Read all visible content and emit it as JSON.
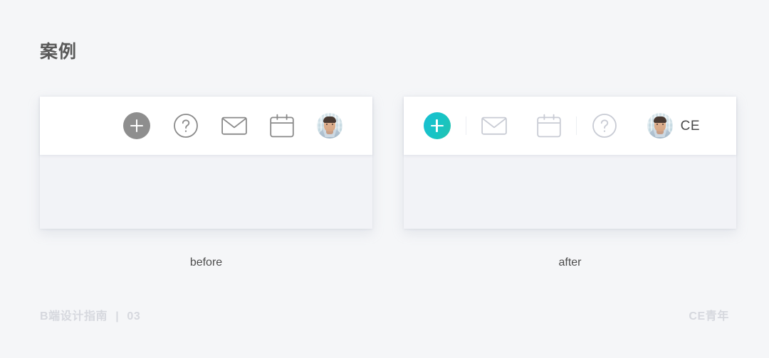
{
  "page": {
    "title": "案例",
    "background_color": "#f5f6f8"
  },
  "colors": {
    "accent_teal": "#17c4c4",
    "before_plus_gray": "#8e8e8e",
    "before_icon_gray": "#8a8a8a",
    "after_icon_gray": "#c8cbd4",
    "card_body": "#f2f3f7",
    "toolbar_white": "#ffffff",
    "title_text": "#595959",
    "footer_text": "#d6d8de"
  },
  "examples": [
    {
      "id": "before",
      "caption": "before",
      "toolbar": {
        "items": [
          {
            "name": "add-button",
            "icon": "plus-icon",
            "style": "filled-gray",
            "label": ""
          },
          {
            "name": "help-button",
            "icon": "question-circle-icon",
            "style": "outline",
            "label": ""
          },
          {
            "name": "mail-button",
            "icon": "envelope-icon",
            "style": "outline",
            "label": ""
          },
          {
            "name": "calendar-button",
            "icon": "calendar-icon",
            "style": "outline",
            "label": ""
          },
          {
            "name": "user-avatar",
            "icon": "avatar-icon",
            "style": "photo",
            "label": ""
          }
        ]
      }
    },
    {
      "id": "after",
      "caption": "after",
      "toolbar": {
        "items": [
          {
            "name": "add-button",
            "icon": "plus-icon",
            "style": "filled-teal",
            "label": ""
          },
          {
            "name": "toolbar-divider",
            "icon": "divider-icon",
            "style": "divider",
            "label": ""
          },
          {
            "name": "mail-button",
            "icon": "envelope-icon",
            "style": "outline-light",
            "label": ""
          },
          {
            "name": "calendar-button",
            "icon": "calendar-icon",
            "style": "outline-light",
            "label": ""
          },
          {
            "name": "toolbar-divider",
            "icon": "divider-icon",
            "style": "divider",
            "label": ""
          },
          {
            "name": "help-button",
            "icon": "question-circle-icon",
            "style": "outline-light",
            "label": ""
          },
          {
            "name": "user-avatar",
            "icon": "avatar-icon",
            "style": "photo",
            "label": ""
          }
        ],
        "user_label": "CE"
      }
    }
  ],
  "footer": {
    "left_text": "B端设计指南",
    "left_separator": "|",
    "left_number": "03",
    "right_text": "CE青年"
  }
}
